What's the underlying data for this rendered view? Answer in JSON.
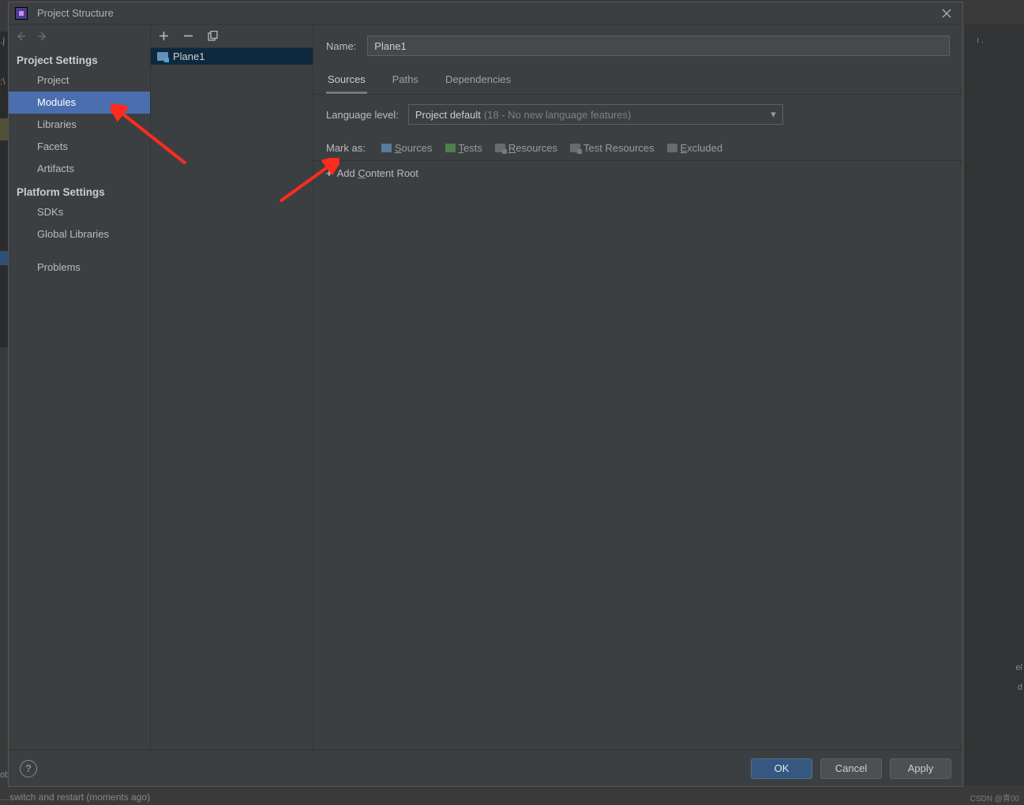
{
  "dialog": {
    "title": "Project Structure"
  },
  "sidebar": {
    "headings": {
      "project_settings": "Project Settings",
      "platform_settings": "Platform Settings"
    },
    "items": {
      "project": "Project",
      "modules": "Modules",
      "libraries": "Libraries",
      "facets": "Facets",
      "artifacts": "Artifacts",
      "sdks": "SDKs",
      "global_libraries": "Global Libraries",
      "problems": "Problems"
    }
  },
  "modules": {
    "list": [
      {
        "name": "Plane1"
      }
    ]
  },
  "main": {
    "name_label": "Name:",
    "name_value": "Plane1",
    "tabs": {
      "sources": "Sources",
      "paths": "Paths",
      "dependencies": "Dependencies"
    },
    "language_level_label": "Language level:",
    "language_level_value": "Project default",
    "language_level_hint": " (18 - No new language features)",
    "mark_as_label": "Mark as:",
    "mark_items": {
      "sources": "Sources",
      "tests": "Tests",
      "resources": "Resources",
      "test_resources": "Test Resources",
      "excluded": "Excluded"
    },
    "add_content_root": "Add Content Root"
  },
  "footer": {
    "ok": "OK",
    "cancel": "Cancel",
    "apply": "Apply"
  },
  "watermark": "CSDN @青00",
  "outer_bottom": "…switch and restart (moments ago)"
}
